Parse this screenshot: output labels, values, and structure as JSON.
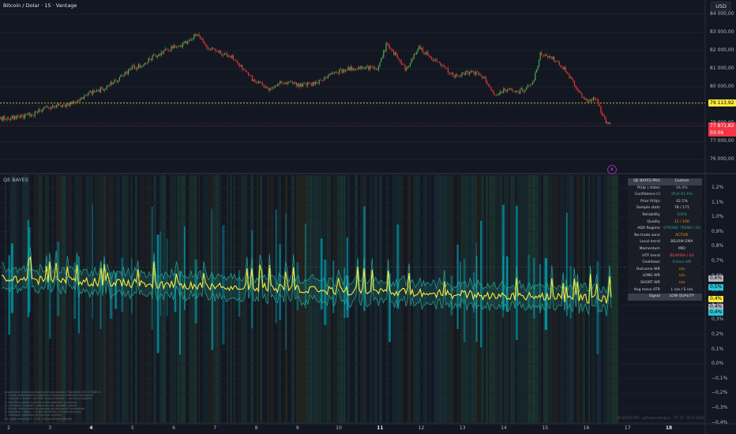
{
  "header": {
    "title": "Bitcoin / Dolar · 15 · Vantage",
    "currency": "USD"
  },
  "price_axis": {
    "labels": [
      "84 000,00",
      "83 000,00",
      "82 000,00",
      "81 000,00",
      "80 000,00",
      "79 000,00",
      "78 000,00",
      "77 000,00",
      "76 000,00"
    ],
    "values": [
      84000,
      83000,
      82000,
      81000,
      80000,
      79000,
      78000,
      77000,
      76000
    ]
  },
  "price_tags": {
    "level_label": "79 113,92",
    "level_value": 79113.92,
    "last_label": "77 871,82",
    "last_countdown": "03:06",
    "last_value": 77871.82
  },
  "price_series": {
    "anchors": [
      [
        0,
        78250
      ],
      [
        25,
        78350
      ],
      [
        45,
        78550
      ],
      [
        60,
        78900
      ],
      [
        80,
        79000
      ],
      [
        100,
        79200
      ],
      [
        115,
        79700
      ],
      [
        130,
        79900
      ],
      [
        150,
        80400
      ],
      [
        165,
        81000
      ],
      [
        180,
        81200
      ],
      [
        195,
        81700
      ],
      [
        215,
        82100
      ],
      [
        235,
        82400
      ],
      [
        250,
        83000
      ],
      [
        262,
        82200
      ],
      [
        278,
        81900
      ],
      [
        295,
        81600
      ],
      [
        320,
        80400
      ],
      [
        340,
        79900
      ],
      [
        360,
        80300
      ],
      [
        380,
        80100
      ],
      [
        400,
        80200
      ],
      [
        420,
        80700
      ],
      [
        440,
        81000
      ],
      [
        460,
        81100
      ],
      [
        478,
        81000
      ],
      [
        490,
        82400
      ],
      [
        505,
        81500
      ],
      [
        515,
        80900
      ],
      [
        530,
        82200
      ],
      [
        545,
        81600
      ],
      [
        560,
        81200
      ],
      [
        575,
        80600
      ],
      [
        595,
        80800
      ],
      [
        612,
        80600
      ],
      [
        627,
        79400
      ],
      [
        640,
        79900
      ],
      [
        655,
        79700
      ],
      [
        665,
        79900
      ],
      [
        675,
        80300
      ],
      [
        685,
        81900
      ],
      [
        700,
        81600
      ],
      [
        715,
        81000
      ],
      [
        730,
        79900
      ],
      [
        740,
        79300
      ],
      [
        755,
        79300
      ],
      [
        765,
        78200
      ],
      [
        773,
        77870
      ]
    ]
  },
  "indicator": {
    "title": "QE BAYES",
    "axis_labels": [
      "1,2%",
      "1,1%",
      "1,0%",
      "0,9%",
      "0,8%",
      "0,7%",
      "0,6%",
      "0,5%",
      "0,4%",
      "0,3%",
      "0,2%",
      "0,1%",
      "0,0%",
      "−0,1%",
      "−0,2%",
      "−0,3%",
      "−0,4%"
    ],
    "axis_values": [
      1.2,
      1.1,
      1.0,
      0.9,
      0.8,
      0.7,
      0.6,
      0.5,
      0.4,
      0.3,
      0.2,
      0.1,
      0.0,
      -0.1,
      -0.2,
      -0.3,
      -0.4
    ],
    "tags": [
      {
        "label": "0,6%",
        "color": "#b2b5be"
      },
      {
        "label": "0,5%",
        "color": "#26c6da"
      },
      {
        "label": "0,4%",
        "color": "#ffeb3b"
      },
      {
        "label": "0,4%",
        "color": "#b2b5be"
      },
      {
        "label": "0,4%",
        "color": "#26c6da"
      }
    ],
    "tag_values": [
      0.58,
      0.52,
      0.44,
      0.39,
      0.35
    ],
    "colors": {
      "main": "#ffeb3b",
      "band": "#26a69a",
      "spike": "#00acc1"
    }
  },
  "stats_table": {
    "header": {
      "key": "QE BAYES PRO",
      "value": "Custom"
    },
    "rows": [
      {
        "key": "P(Up | state)",
        "value": "44.4%",
        "color": "#b2b5be"
      },
      {
        "key": "Confidence CI",
        "value": "26.8–61.6%",
        "color": "#26a69a"
      },
      {
        "key": "Prior P(Up)",
        "value": "42.1%",
        "color": "#d1d4dc"
      },
      {
        "key": "Sample stats",
        "value": "78 / 171",
        "color": "#d1d4dc"
      },
      {
        "key": "Reliability",
        "value": "100%",
        "color": "#26a69a"
      },
      {
        "key": "Quality",
        "value": "11 / 100",
        "color": "#ff9800"
      },
      {
        "key": "ADX Regime",
        "value": "STRONG TREND / 60",
        "color": "#26a69a"
      },
      {
        "key": "No-trade zone",
        "value": "ACTIVE",
        "color": "#ff9800"
      },
      {
        "key": "Local trend",
        "value": "BELOW EMA",
        "color": "#d1d4dc"
      },
      {
        "key": "Momentum",
        "value": "MID",
        "color": "#d1d4dc"
      },
      {
        "key": "HTF trend",
        "value": "BEARISH / 60",
        "color": "#ef5350"
      },
      {
        "key": "Cooldown",
        "value": "0 bars left",
        "color": "#26a69a"
      },
      {
        "key": "Outcome WR",
        "value": "n/a",
        "color": "#ff9800"
      },
      {
        "key": "LONG WR",
        "value": "n/a",
        "color": "#ff9800"
      },
      {
        "key": "SHORT WR",
        "value": "n/a",
        "color": "#ff9800"
      },
      {
        "key": "Avg move ATR",
        "value": "L n/a / S n/a",
        "color": "#d1d4dc"
      }
    ],
    "signal": {
      "key": "Signal",
      "value": "LOW QUALITY"
    }
  },
  "dates": [
    {
      "label": "2",
      "bold": false
    },
    {
      "label": "3",
      "bold": false
    },
    {
      "label": "4",
      "bold": true
    },
    {
      "label": "5",
      "bold": false
    },
    {
      "label": "6",
      "bold": false
    },
    {
      "label": "7",
      "bold": false
    },
    {
      "label": "8",
      "bold": false
    },
    {
      "label": "9",
      "bold": false
    },
    {
      "label": "10",
      "bold": false
    },
    {
      "label": "11",
      "bold": true
    },
    {
      "label": "12",
      "bold": false
    },
    {
      "label": "13",
      "bold": false
    },
    {
      "label": "14",
      "bold": false
    },
    {
      "label": "15",
      "bold": false
    },
    {
      "label": "16",
      "bold": false
    },
    {
      "label": "17",
      "bold": false
    },
    {
      "label": "18",
      "bold": true
    }
  ],
  "notes": [
    "Analiza jest wyłącznie wsparciem dla twojego TRADINGU DECYZYJNEGO.",
    "1. Szukaj potwierdzenia sygnału na wyższym interwale czasowym.",
    "2. Sygnały w strefie no-trade są ignorowane — czekaj na wybicie.",
    "3. Weryfikuj jakość sygnału przed wejściem w pozycję.",
    "4. Zarządzaj ryzykiem: stop loss oraz wielkość pozycji.",
    "5. Wyniki historyczne nie gwarantują przyszłych rezultatów.",
    "6. Korzystaj z Bayes + ADX jako filtrów, nie jako wyroczni.",
    "7. Obserwuj cooldown po każdym sygnale.",
    "All rights reserved © 2025 TheQuantEngineTrader"
  ],
  "watermark": "QE BAYES PRO · @thequantengine · TF: 15 · 01.11.2025"
}
